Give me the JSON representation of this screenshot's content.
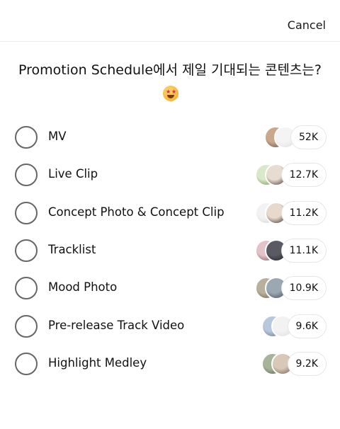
{
  "header": {
    "cancel_label": "Cancel"
  },
  "poll": {
    "question_text": "Promotion Schedule에서 제일 기대되는 콘텐츠는?",
    "question_emoji": "star-struck-emoji",
    "options": [
      {
        "label": "MV",
        "count": "52K",
        "avatars": [
          [
            "#c9a88c",
            "#5a4a44"
          ],
          [
            "#f4f4f4",
            "#dcdcdc"
          ]
        ]
      },
      {
        "label": "Live Clip",
        "count": "12.7K",
        "avatars": [
          [
            "#d8e8c8",
            "#6e8a4a"
          ],
          [
            "#e6dccf",
            "#3a2c22"
          ]
        ]
      },
      {
        "label": "Concept Photo & Concept Clip",
        "count": "11.2K",
        "avatars": [
          [
            "#f2f2f2",
            "#d0d0d0"
          ],
          [
            "#e8d9cc",
            "#2a2320"
          ]
        ]
      },
      {
        "label": "Tracklist",
        "count": "11.1K",
        "avatars": [
          [
            "#e3c2c8",
            "#7a4a52"
          ],
          [
            "#5a5a62",
            "#1a1a20"
          ]
        ]
      },
      {
        "label": "Mood Photo",
        "count": "10.9K",
        "avatars": [
          [
            "#b8b09a",
            "#6a5e48"
          ],
          [
            "#9aa8b4",
            "#3c4652"
          ]
        ]
      },
      {
        "label": "Pre-release Track Video",
        "count": "9.6K",
        "avatars": [
          [
            "#b7c8dc",
            "#5a6e8a"
          ],
          [
            "#f2f2f2",
            "#dedede"
          ]
        ]
      },
      {
        "label": "Highlight Medley",
        "count": "9.2K",
        "avatars": [
          [
            "#a8b49a",
            "#4e5a44"
          ],
          [
            "#d8c8b8",
            "#6a5444"
          ]
        ]
      }
    ]
  },
  "colors": {
    "radio_border": "#666666",
    "divider": "#ececec"
  }
}
